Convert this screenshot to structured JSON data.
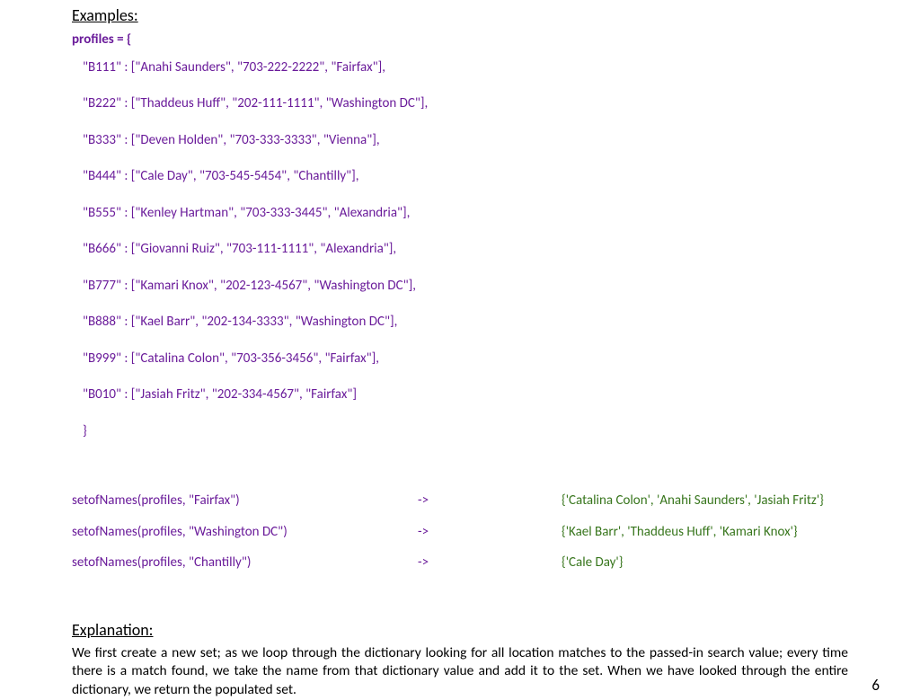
{
  "headings": {
    "examples": "Examples:",
    "explanation": "Explanation:"
  },
  "code": {
    "header": "profiles = {",
    "lines": [
      "\"B111\" : [\"Anahi Saunders\", \"703-222-2222\", \"Fairfax\"],",
      "\"B222\" : [\"Thaddeus Huff\", \"202-111-1111\", \"Washington DC\"],",
      "\"B333\" : [\"Deven Holden\", \"703-333-3333\", \"Vienna\"],",
      "\"B444\" : [\"Cale Day\", \"703-545-5454\", \"Chantilly\"],",
      "\"B555\" : [\"Kenley Hartman\", \"703-333-3445\", \"Alexandria\"],",
      "\"B666\" : [\"Giovanni Ruiz\", \"703-111-1111\", \"Alexandria\"],",
      "\"B777\" : [\"Kamari Knox\", \"202-123-4567\", \"Washington DC\"],",
      "\"B888\" : [\"Kael Barr\", \"202-134-3333\", \"Washington DC\"],",
      "\"B999\" : [\"Catalina Colon\", \"703-356-3456\", \"Fairfax\"],",
      "\"B010\" : [\"Jasiah Fritz\", \"202-334-4567\", \"Fairfax\"]"
    ],
    "close": "}"
  },
  "arrow": "->",
  "examples": [
    {
      "call": "setofNames(profiles, \"Fairfax\")",
      "result": "{'Catalina Colon', 'Anahi Saunders', 'Jasiah Fritz'}"
    },
    {
      "call": "setofNames(profiles, \"Washington DC\")",
      "result": "{'Kael Barr', 'Thaddeus Huff', 'Kamari Knox'}"
    },
    {
      "call": "setofNames(profiles, \"Chantilly\")",
      "result": "{'Cale Day'}"
    }
  ],
  "explanation": "We first create a new set; as we loop through the dictionary looking for all location matches to the passed-in search value; every time there is a match found, we take the name from that dictionary value and add it to the set. When we have looked through the entire dictionary, we return the populated set.",
  "pageNumber": "6"
}
